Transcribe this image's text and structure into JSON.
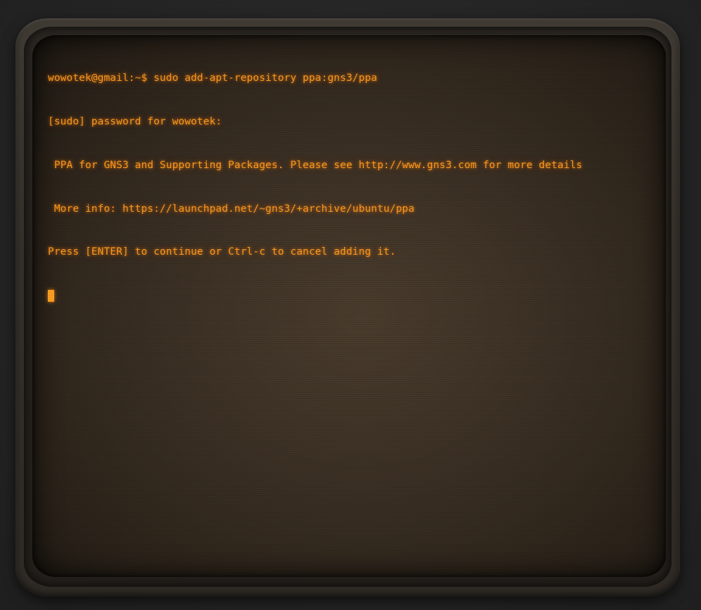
{
  "terminal": {
    "lines": [
      "wowotek@gmail:~$ sudo add-apt-repository ppa:gns3/ppa",
      "[sudo] password for wowotek:",
      " PPA for GNS3 and Supporting Packages. Please see http://www.gns3.com for more details",
      " More info: https://launchpad.net/~gns3/+archive/ubuntu/ppa",
      "Press [ENTER] to continue or Ctrl-c to cancel adding it."
    ]
  },
  "theme": {
    "text_color": "#ff9a1f",
    "screen_color": "#3a2f23",
    "bezel_color": "#35302a"
  }
}
